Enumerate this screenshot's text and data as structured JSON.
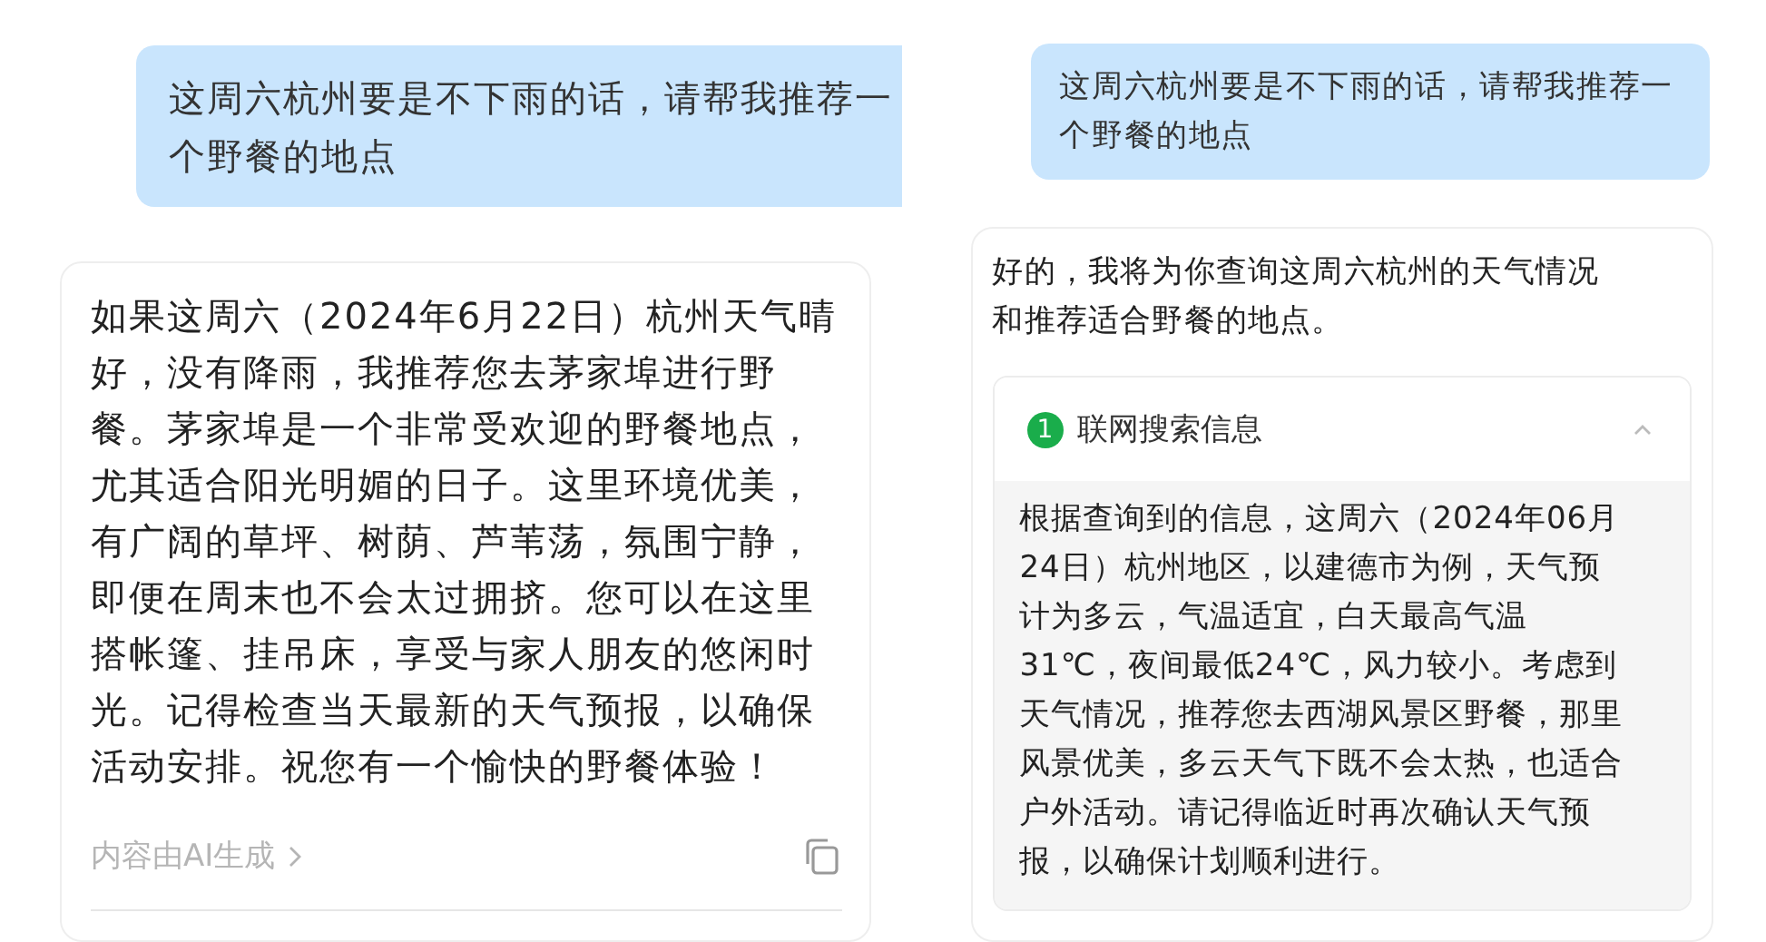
{
  "left_panel": {
    "user_message": "这周六杭州要是不下雨的话，请帮我推荐一个野餐的地点",
    "reply": {
      "text": "如果这周六（2024年6月22日）杭州天气晴好，没有降雨，我推荐您去茅家埠进行野餐。茅家埠是一个非常受欢迎的野餐地点，尤其适合阳光明媚的日子。这里环境优美，有广阔的草坪、树荫、芦苇荡，氛围宁静，即便在周末也不会太过拥挤。您可以在这里搭帐篷、挂吊床，享受与家人朋友的悠闲时光。记得检查当天最新的天气预报，以确保活动安排。祝您有一个愉快的野餐体验！",
      "footer_note": "内容由AI生成"
    }
  },
  "right_panel": {
    "user_message": "这周六杭州要是不下雨的话，请帮我推荐一个野餐的地点",
    "reply": {
      "intro": "好的，我将为你查询这周六杭州的天气情况和推荐适合野餐的地点。",
      "search_panel": {
        "step": "1",
        "title": "联网搜索信息",
        "expanded": true,
        "result": "根据查询到的信息，这周六（2024年06月24日）杭州地区，以建德市为例，天气预计为多云，气温适宜，白天最高气温31℃，夜间最低24℃，风力较小。考虑到天气情况，推荐您去西湖风景区野餐，那里风景优美，多云天气下既不会太热，也适合户外活动。请记得临近时再次确认天气预报，以确保计划顺利进行。"
      }
    }
  }
}
